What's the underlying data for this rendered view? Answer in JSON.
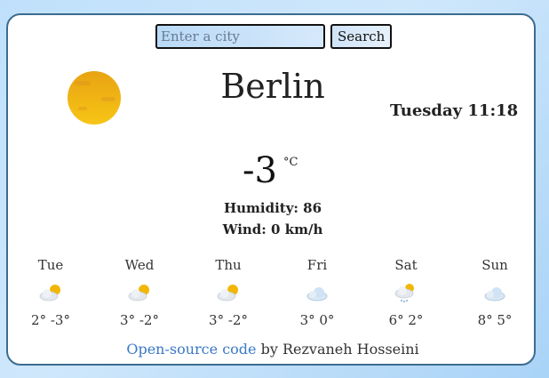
{
  "search": {
    "placeholder": "Enter a city",
    "button_label": "Search"
  },
  "current": {
    "city": "Berlin",
    "datetime": "Tuesday 11:18",
    "temperature": "-3",
    "unit": "°C",
    "humidity": "Humidity: 86",
    "wind": "Wind: 0 km/h",
    "icon": "sun-icon"
  },
  "forecast": [
    {
      "day": "Tue",
      "temps": "2° -3°",
      "icon": "partly-cloudy-icon"
    },
    {
      "day": "Wed",
      "temps": "3° -2°",
      "icon": "partly-cloudy-icon"
    },
    {
      "day": "Thu",
      "temps": "3° -2°",
      "icon": "partly-cloudy-icon"
    },
    {
      "day": "Fri",
      "temps": "3° 0°",
      "icon": "cloudy-icon"
    },
    {
      "day": "Sat",
      "temps": "6° 2°",
      "icon": "rain-icon"
    },
    {
      "day": "Sun",
      "temps": "8° 5°",
      "icon": "cloudy-icon"
    }
  ],
  "footer": {
    "link_text": "Open-source code",
    "author_text": " by Rezvaneh Hosseini"
  },
  "colors": {
    "accent_link": "#3a78c8",
    "card_border": "#3c6c8f",
    "sun": "#f2b705"
  }
}
